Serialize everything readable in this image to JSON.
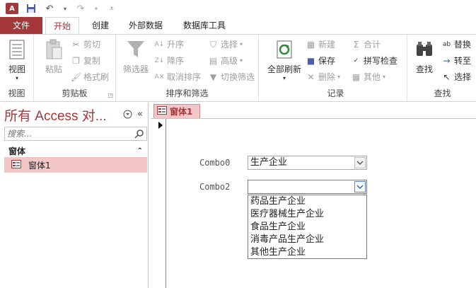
{
  "qat": {
    "app_logo": "A",
    "save_icon": "save-icon",
    "undo_icon": "undo-icon",
    "redo_icon": "redo-icon",
    "customize_icon": "customize-icon"
  },
  "tabs": [
    "文件",
    "开始",
    "创建",
    "外部数据",
    "数据库工具"
  ],
  "ribbon": {
    "view": {
      "view_label": "视图",
      "title": "视图"
    },
    "clipboard": {
      "paste_label": "粘贴",
      "cut_label": "剪切",
      "copy_label": "复制",
      "format_painter_label": "格式刷",
      "title": "剪贴板"
    },
    "sort_filter": {
      "filter_label": "筛选器",
      "ascending_label": "升序",
      "descending_label": "降序",
      "remove_sort_label": "取消排序",
      "selection_label": "选择",
      "advanced_label": "高级",
      "toggle_filter_label": "切换筛选",
      "title": "排序和筛选"
    },
    "records": {
      "refresh_all_label": "全部刷新",
      "new_label": "新建",
      "save_label": "保存",
      "delete_label": "删除",
      "totals_label": "合计",
      "spelling_label": "拼写检查",
      "more_label": "其他",
      "title": "记录"
    },
    "find": {
      "find_label": "查找",
      "replace_label": "替换",
      "goto_label": "转至",
      "select_label": "选择",
      "title": "查找"
    }
  },
  "nav": {
    "title": "所有 Access 对...",
    "search_placeholder": "搜索...",
    "section": "窗体",
    "items": [
      {
        "label": "窗体1"
      }
    ]
  },
  "document": {
    "tab_label": "窗体1",
    "combo0": {
      "label": "Combo0",
      "value": "生产企业"
    },
    "combo2": {
      "label": "Combo2",
      "value": "",
      "options": [
        "药品生产企业",
        "医疗器械生产企业",
        "食品生产企业",
        "消毒产品生产企业",
        "其他生产企业"
      ]
    }
  },
  "colors": {
    "accent": "#a4373a",
    "selected_bg": "#f3c6c7"
  }
}
